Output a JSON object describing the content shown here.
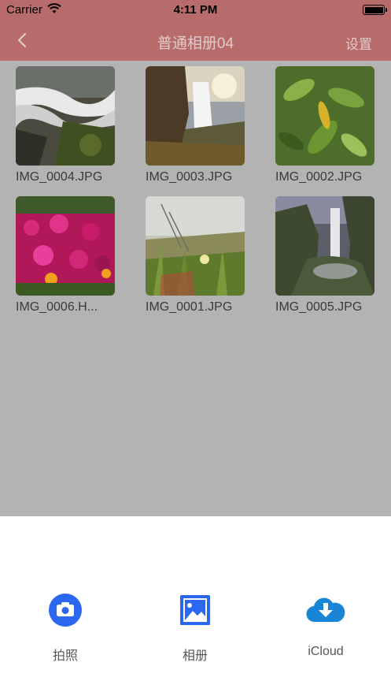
{
  "status": {
    "carrier": "Carrier",
    "time": "4:11 PM"
  },
  "nav": {
    "back_icon": "chevron-left-icon",
    "title": "普通相册04",
    "settings_label": "设置"
  },
  "photos": [
    {
      "name": "IMG_0004.JPG"
    },
    {
      "name": "IMG_0003.JPG"
    },
    {
      "name": "IMG_0002.JPG"
    },
    {
      "name": "IMG_0006.H..."
    },
    {
      "name": "IMG_0001.JPG"
    },
    {
      "name": "IMG_0005.JPG"
    }
  ],
  "sheet": {
    "actions": [
      {
        "label": "拍照",
        "icon": "camera-icon",
        "color": "#2c67f2"
      },
      {
        "label": "相册",
        "icon": "image-icon",
        "color": "#2c67f2"
      },
      {
        "label": "iCloud",
        "icon": "cloud-download-icon",
        "color": "#1a84d6"
      }
    ]
  },
  "colors": {
    "nav_bg": "#b76b6b",
    "overlay_bg": "#b3b3b3",
    "sheet_bg": "#ffffff"
  }
}
